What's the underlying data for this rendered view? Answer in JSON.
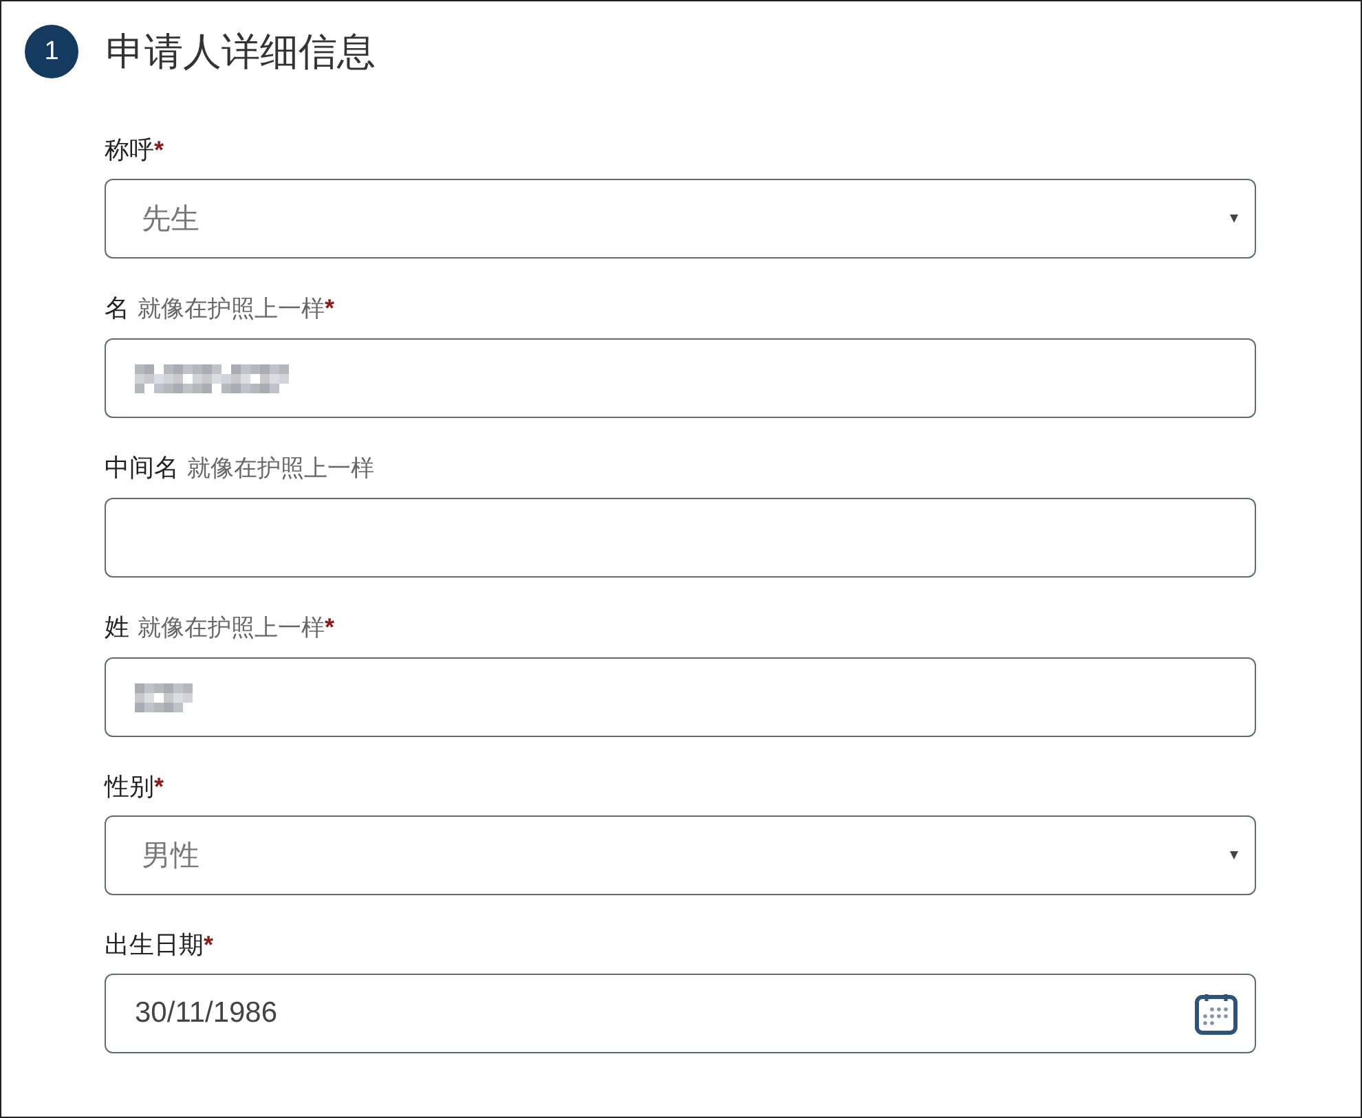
{
  "section": {
    "number": "1",
    "title": "申请人详细信息"
  },
  "fields": [
    {
      "kind": "select",
      "label": "称呼",
      "required_mark": "*",
      "value": "先生"
    },
    {
      "kind": "text",
      "label": "名",
      "hint": "就像在护照上一样",
      "required_mark": "*",
      "redacted": true
    },
    {
      "kind": "text",
      "label": "中间名",
      "hint": "就像在护照上一样"
    },
    {
      "kind": "text",
      "label": "姓",
      "hint": "就像在护照上一样",
      "required_mark": "*",
      "redacted": true
    },
    {
      "kind": "select",
      "label": "性别",
      "required_mark": "*",
      "value": "男性"
    },
    {
      "kind": "date",
      "label": "出生日期",
      "required_mark": "*",
      "value": "30/11/1986"
    }
  ]
}
